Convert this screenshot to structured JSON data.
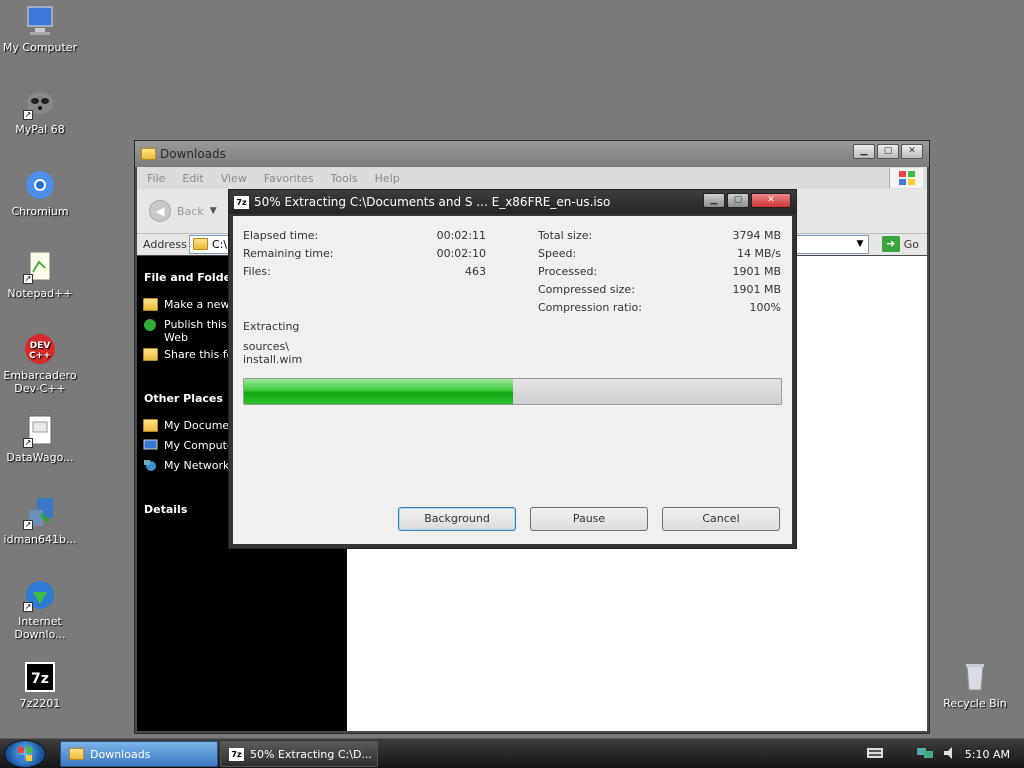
{
  "desktop": {
    "icons": [
      {
        "label": "My Computer",
        "icon": "computer-icon"
      },
      {
        "label": "MyPal 68",
        "icon": "mypal-icon"
      },
      {
        "label": "Chromium",
        "icon": "chromium-icon"
      },
      {
        "label": "Notepad++",
        "icon": "notepadpp-icon"
      },
      {
        "label": "Embarcadero Dev-C++",
        "icon": "devcpp-icon"
      },
      {
        "label": "DataWago...",
        "icon": "datawago-icon"
      },
      {
        "label": "idman641b...",
        "icon": "idman-icon"
      },
      {
        "label": "Internet Downlo...",
        "icon": "idm-icon"
      },
      {
        "label": "7z2201",
        "icon": "7zip-icon"
      },
      {
        "label": "Recycle Bin",
        "icon": "recycle-bin-icon"
      }
    ]
  },
  "explorer": {
    "title": "Downloads",
    "menu": [
      "File",
      "Edit",
      "View",
      "Favorites",
      "Tools",
      "Help"
    ],
    "back_label": "Back",
    "address_label": "Address",
    "address_value": "C:\\",
    "go_label": "Go",
    "sidepane": {
      "file_folder_title": "File and Folder T",
      "tasks": [
        "Make a new",
        "Publish this Web",
        "Share this fo"
      ],
      "other_places_title": "Other Places",
      "places": [
        "My Documen",
        "My Compute",
        "My Network"
      ],
      "details_title": "Details"
    }
  },
  "dialog": {
    "title": "50% Extracting C:\\Documents and S ... E_x86FRE_en-us.iso",
    "left_stats": [
      {
        "label": "Elapsed time:",
        "value": "00:02:11"
      },
      {
        "label": "Remaining time:",
        "value": "00:02:10"
      },
      {
        "label": "Files:",
        "value": "463"
      }
    ],
    "right_stats": [
      {
        "label": "Total size:",
        "value": "3794 MB"
      },
      {
        "label": "Speed:",
        "value": "14 MB/s"
      },
      {
        "label": "Processed:",
        "value": "1901 MB"
      },
      {
        "label": "Compressed size:",
        "value": "1901 MB"
      },
      {
        "label": "Compression ratio:",
        "value": "100%"
      }
    ],
    "status_label": "Extracting",
    "current_path": "sources\\",
    "current_file": "install.wim",
    "progress_fraction": 0.5,
    "buttons": {
      "background": "Background",
      "pause": "Pause",
      "cancel": "Cancel"
    }
  },
  "taskbar": {
    "tasks": [
      {
        "label": "Downloads",
        "active": true
      },
      {
        "label": "50% Extracting C:\\D...",
        "active": false
      }
    ],
    "clock": "5:10 AM"
  },
  "colors": {
    "desktop_bg": "#7a7a7a",
    "progress_fill": "#2ec42e"
  }
}
